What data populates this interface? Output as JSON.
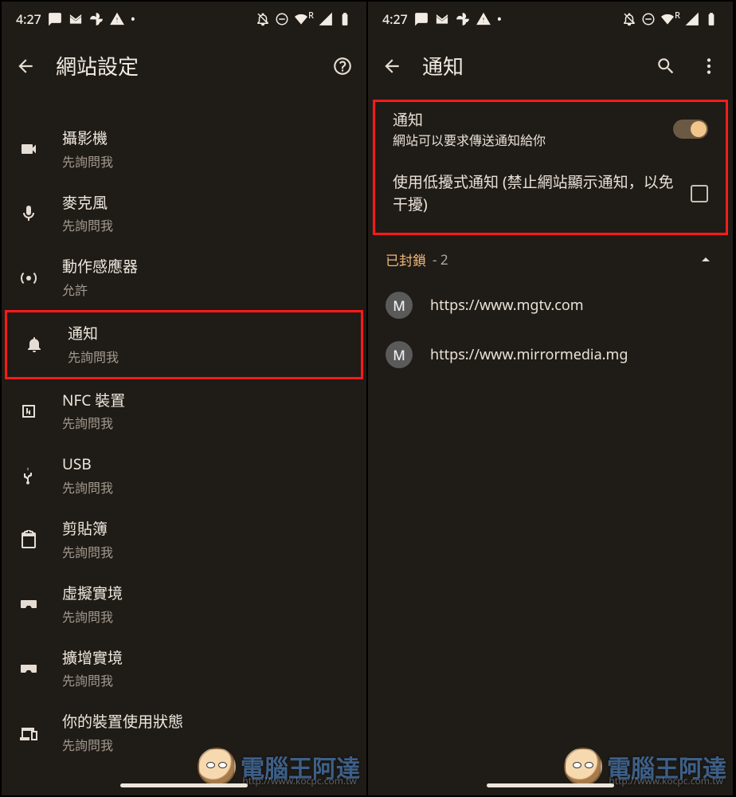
{
  "status": {
    "time": "4:27",
    "superscript": "R"
  },
  "left": {
    "title": "網站設定",
    "items": [
      {
        "key": "camera",
        "label": "攝影機",
        "sub": "先詢問我"
      },
      {
        "key": "mic",
        "label": "麥克風",
        "sub": "先詢問我"
      },
      {
        "key": "motion",
        "label": "動作感應器",
        "sub": "允許"
      },
      {
        "key": "notify",
        "label": "通知",
        "sub": "先詢問我"
      },
      {
        "key": "nfc",
        "label": "NFC 裝置",
        "sub": "先詢問我"
      },
      {
        "key": "usb",
        "label": "USB",
        "sub": "先詢問我"
      },
      {
        "key": "clip",
        "label": "剪貼簿",
        "sub": "先詢問我"
      },
      {
        "key": "vr",
        "label": "虛擬實境",
        "sub": "先詢問我"
      },
      {
        "key": "ar",
        "label": "擴增實境",
        "sub": "先詢問我"
      },
      {
        "key": "device",
        "label": "你的裝置使用狀態",
        "sub": "先詢問我"
      }
    ]
  },
  "right": {
    "title": "通知",
    "toggle": {
      "label": "通知",
      "sub": "網站可以要求傳送通知給你"
    },
    "quiet": {
      "label": "使用低擾式通知 (禁止網站顯示通知，以免干擾)"
    },
    "blocked": {
      "label": "已封鎖",
      "count": "- 2"
    },
    "sites": [
      {
        "initial": "M",
        "url": "https://www.mgtv.com"
      },
      {
        "initial": "M",
        "url": "https://www.mirrormedia.mg"
      }
    ]
  },
  "watermark": {
    "text": "電腦王阿達",
    "sub": "http://www.kocpc.com.tw"
  }
}
